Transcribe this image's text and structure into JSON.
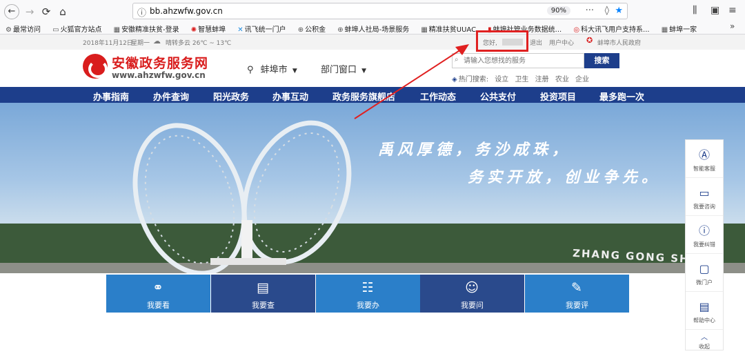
{
  "browser": {
    "url": "bb.ahzwfw.gov.cn",
    "zoom": "90%",
    "bookmarks": [
      "最常访问",
      "火狐官方站点",
      "安徽精准扶贫-登录",
      "智慧蚌埠",
      "讯飞统一门户",
      "公积金",
      "蚌埠人社局-场景服务",
      "精准扶贫UUAC",
      "蚌埠社管业务数据统...",
      "科大讯飞用户支持系...",
      "蚌埠一家"
    ]
  },
  "info_bar": {
    "date": "2018年11月12日",
    "weekday": "星期一",
    "weather": "晴转多云 26℃ ~ 13℃",
    "greeting": "您好,",
    "logout": "退出",
    "user_center": "用户中心",
    "gov_link": "蚌埠市人民政府"
  },
  "header": {
    "title": "安徽政务服务网",
    "url": "www.ahzwfw.gov.cn",
    "city": "蚌埠市",
    "dept": "部门窗口",
    "search_placeholder": "请输入您想找的服务",
    "search_button": "搜索",
    "hot_label": "热门搜索:",
    "hot_items": [
      "设立",
      "卫生",
      "注册",
      "农业",
      "企业"
    ]
  },
  "nav": [
    "办事指南",
    "办件查询",
    "阳光政务",
    "办事互动",
    "政务服务旗舰店",
    "工作动态",
    "公共支付",
    "投资项目",
    "最多跑一次"
  ],
  "banner": {
    "slogan1": "禹风厚德，务沙成珠，",
    "slogan2": "务实开放，创业争先。",
    "sign": "ZHANG GONG SHAN"
  },
  "services": [
    {
      "label": "我要看",
      "icon": "glasses-icon",
      "color": "#2b7fc9"
    },
    {
      "label": "我要查",
      "icon": "search-doc-icon",
      "color": "#2a4a8c"
    },
    {
      "label": "我要办",
      "icon": "form-icon",
      "color": "#2b7fc9"
    },
    {
      "label": "我要问",
      "icon": "chat-icon",
      "color": "#2a4a8c"
    },
    {
      "label": "我要评",
      "icon": "rate-icon",
      "color": "#2b7fc9"
    }
  ],
  "side_bar": [
    "智能客服",
    "我要咨询",
    "我要纠错",
    "微门户",
    "帮助中心",
    "收起"
  ],
  "colors": {
    "brand_red": "#d91d1d",
    "nav_blue": "#1d3e8b",
    "highlight": "#e02020"
  }
}
